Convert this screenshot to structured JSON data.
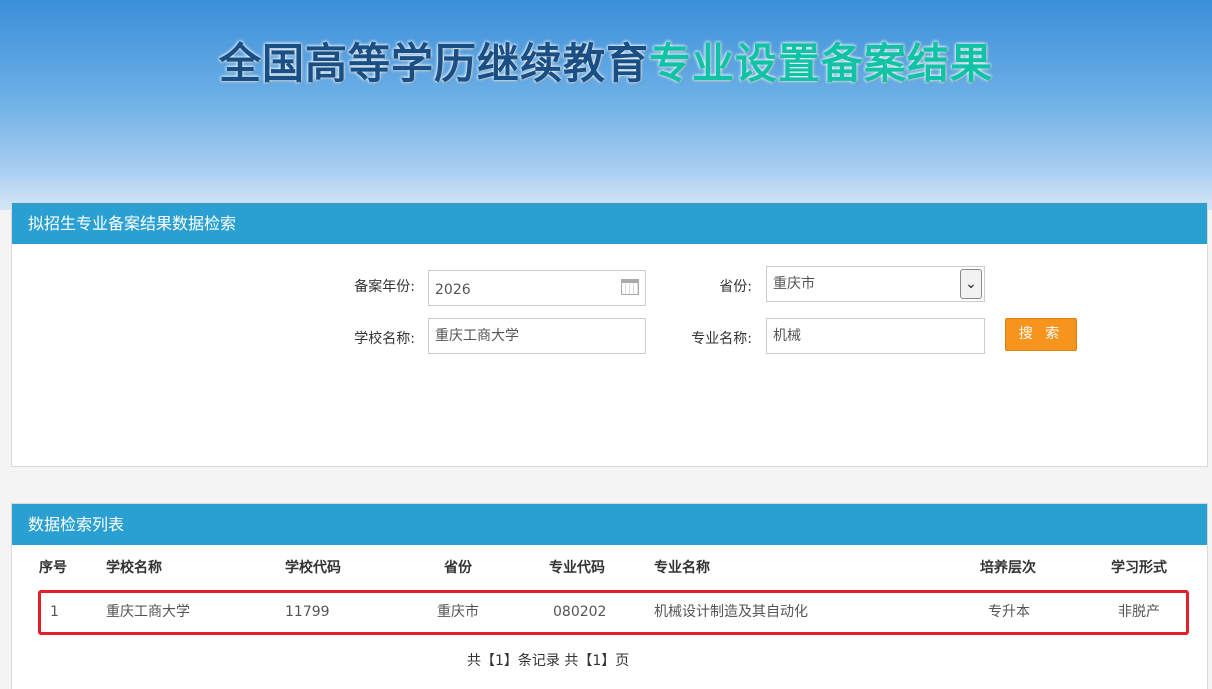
{
  "banner": {
    "title_part1": "全国高等学历继续教育",
    "title_part2": "专业设置备案结果"
  },
  "search": {
    "panel_title": "拟招生专业备案结果数据检索",
    "year_label": "备案年份:",
    "year_value": "2026",
    "province_label": "省份:",
    "province_value": "重庆市",
    "school_label": "学校名称:",
    "school_value": "重庆工商大学",
    "major_label": "专业名称:",
    "major_value": "机械",
    "search_button": "搜 索"
  },
  "results": {
    "panel_title": "数据检索列表",
    "columns": [
      "序号",
      "学校名称",
      "学校代码",
      "省份",
      "专业代码",
      "专业名称",
      "培养层次",
      "学习形式"
    ],
    "rows": [
      [
        "1",
        "重庆工商大学",
        "11799",
        "重庆市",
        "080202",
        "机械设计制造及其自动化",
        "专升本",
        "非脱产"
      ]
    ],
    "pager": "共【1】条记录 共【1】页"
  },
  "colors": {
    "panel_header": "#2aa0d2",
    "search_button": "#f7941d",
    "highlight_border": "#e3202a",
    "title_dark": "#1a4f86",
    "title_green": "#12c2a6"
  },
  "icons": {
    "date_picker": "calendar-icon",
    "select_dropdown": "chevron-down-icon"
  }
}
